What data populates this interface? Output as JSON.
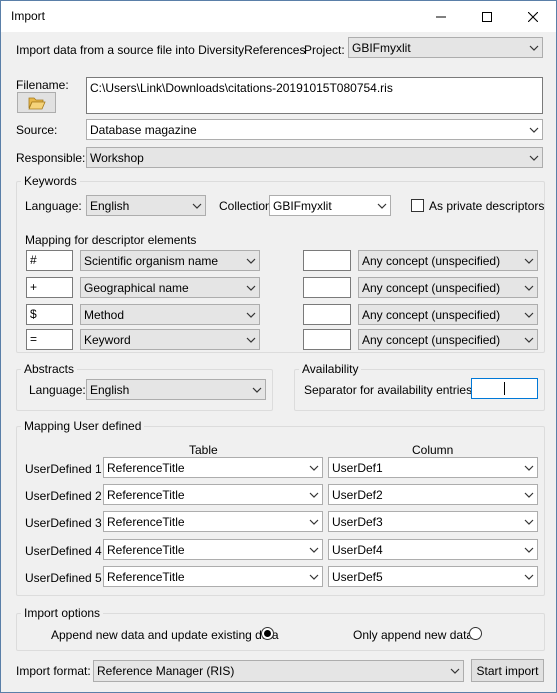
{
  "window": {
    "title": "Import"
  },
  "header": {
    "description": "Import data from a source file into DiversityReferences",
    "project_label": "Project:",
    "project_value": "GBIFmyxlit"
  },
  "file": {
    "filename_label": "Filename:",
    "filename_value": "C:\\Users\\Link\\Downloads\\citations-20191015T080754.ris"
  },
  "source": {
    "label": "Source:",
    "value": "Database magazine"
  },
  "responsible": {
    "label": "Responsible:",
    "value": "Workshop"
  },
  "keywords": {
    "legend": "Keywords",
    "language_label": "Language:",
    "language_value": "English",
    "collection_label": "Collection:",
    "collection_value": "GBIFmyxlit",
    "private_label": "As private descriptors",
    "mapping_label": "Mapping for descriptor elements",
    "rows": [
      {
        "symbol": "#",
        "element": "Scientific organism name",
        "code": "",
        "concept": "Any concept (unspecified)"
      },
      {
        "symbol": "+",
        "element": "Geographical name",
        "code": "",
        "concept": "Any concept (unspecified)"
      },
      {
        "symbol": "$",
        "element": "Method",
        "code": "",
        "concept": "Any concept (unspecified)"
      },
      {
        "symbol": "=",
        "element": "Keyword",
        "code": "",
        "concept": "Any concept (unspecified)"
      }
    ]
  },
  "abstracts": {
    "legend": "Abstracts",
    "language_label": "Language:",
    "language_value": "English"
  },
  "availability": {
    "legend": "Availability",
    "separator_label": "Separator for availability entries:",
    "separator_value": ""
  },
  "user_defined": {
    "legend": "Mapping User defined",
    "table_header": "Table",
    "column_header": "Column",
    "rows": [
      {
        "label": "UserDefined 1",
        "table": "ReferenceTitle",
        "column": "UserDef1"
      },
      {
        "label": "UserDefined 2",
        "table": "ReferenceTitle",
        "column": "UserDef2"
      },
      {
        "label": "UserDefined 3",
        "table": "ReferenceTitle",
        "column": "UserDef3"
      },
      {
        "label": "UserDefined 4",
        "table": "ReferenceTitle",
        "column": "UserDef4"
      },
      {
        "label": "UserDefined 5",
        "table": "ReferenceTitle",
        "column": "UserDef5"
      }
    ]
  },
  "import_options": {
    "legend": "Import options",
    "append_update_label": "Append new data and update existing data",
    "append_only_label": "Only append new data",
    "selected": "append_update"
  },
  "footer": {
    "format_label": "Import format:",
    "format_value": "Reference Manager (RIS)",
    "start_label": "Start import"
  },
  "icons": [
    "folder-open-icon",
    "chevron-down-icon",
    "minimize-icon",
    "maximize-icon",
    "close-icon"
  ]
}
